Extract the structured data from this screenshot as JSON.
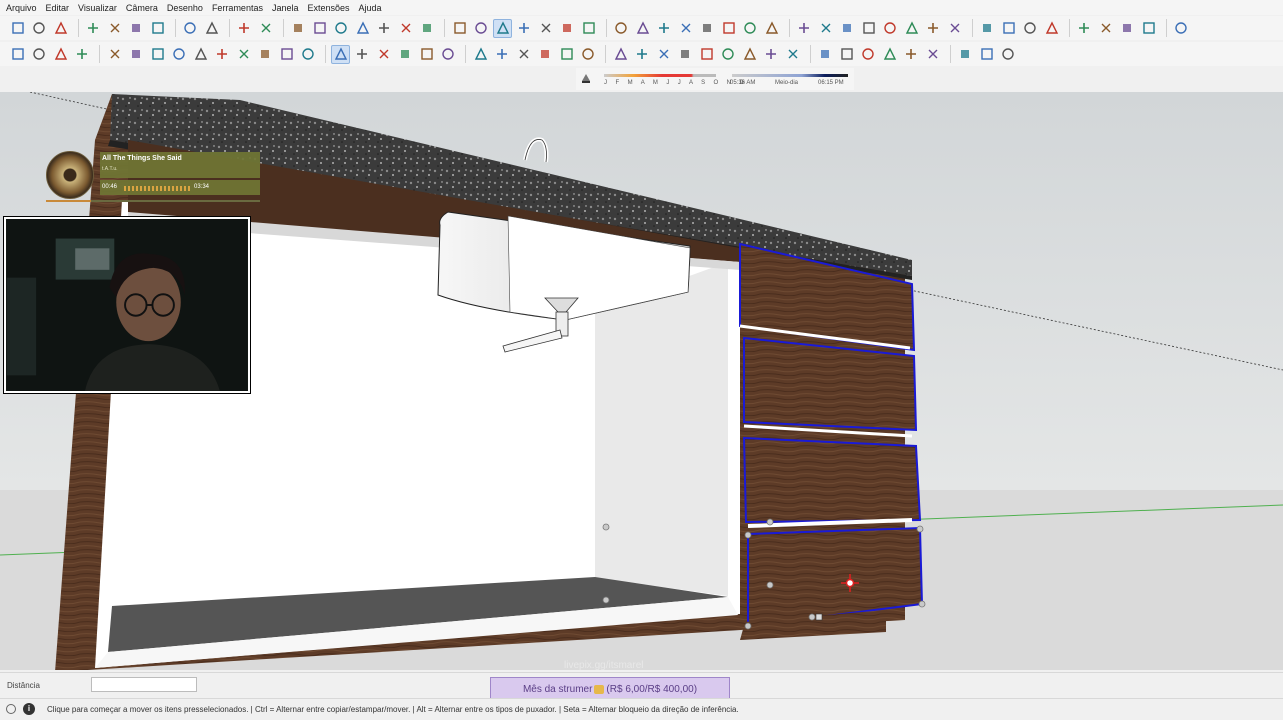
{
  "menu": [
    "Arquivo",
    "Editar",
    "Visualizar",
    "Câmera",
    "Desenho",
    "Ferramentas",
    "Janela",
    "Extensões",
    "Ajuda"
  ],
  "toolbar1": {
    "icons": [
      "new-file-icon",
      "open-file-icon",
      "save-icon",
      "cut-icon",
      "copy-icon",
      "paste-icon",
      "erase-icon",
      "undo-icon",
      "redo-icon",
      "print-icon",
      "model-info-icon",
      "iso-view-icon",
      "top-view-icon",
      "front-view-icon",
      "right-view-icon",
      "back-view-icon",
      "left-view-icon",
      "bottom-view-icon",
      "xray-icon",
      "back-edges-icon",
      "wireframe-icon",
      "hidden-line-icon",
      "shaded-icon",
      "shaded-textures-icon",
      "monochrome-icon",
      "section-plane-icon",
      "display-section-icon",
      "display-cuts-icon",
      "section-fill-icon",
      "components-icon",
      "warehouse-icon",
      "extension-warehouse-icon",
      "layout-icon",
      "model-info-2-icon",
      "entity-info-icon",
      "materials-icon",
      "styles-icon",
      "tags-icon",
      "scenes-icon",
      "shadows-icon",
      "fog-icon",
      "add-location-icon",
      "toggle-terrain-icon",
      "preview-icon",
      "cloud-icon",
      "settings-icon",
      "outliner-icon",
      "info-icon",
      "cart-icon",
      "account-icon"
    ],
    "active": [
      20
    ]
  },
  "toolbar2": {
    "icons": [
      "select-icon",
      "component-icon",
      "paint-bucket-icon",
      "eraser-icon",
      "pencil-icon",
      "freehand-icon",
      "rectangle-icon",
      "rotated-rectangle-icon",
      "circle-icon",
      "polygon-icon",
      "arc-icon",
      "two-point-arc-icon",
      "three-point-arc-icon",
      "pie-icon",
      "move-icon",
      "push-pull-icon",
      "rotate-icon",
      "scale-icon",
      "follow-me-icon",
      "offset-icon",
      "tape-measure-icon",
      "dimension-icon",
      "protractor-icon",
      "text-icon",
      "axes-icon",
      "3d-text-icon",
      "orbit-icon",
      "pan-icon",
      "zoom-icon",
      "zoom-window-icon",
      "zoom-extents-icon",
      "previous-view-icon",
      "position-camera-icon",
      "look-around-icon",
      "walk-icon",
      "solid-outer-icon",
      "solid-intersect-icon",
      "solid-union-icon",
      "solid-subtract-icon",
      "solid-trim-icon",
      "solid-split-icon",
      "sandbox-icon",
      "smoove-icon",
      "stamp-icon"
    ],
    "active": [
      14
    ]
  },
  "shadow": {
    "months": "J F M A M J J A S O N D",
    "time_start": "05:36 AM",
    "time_mid": "Meio-dia",
    "time_end": "06:15 PM"
  },
  "music": {
    "song": "All The Things She Said",
    "artist": "t.A.T.u.",
    "current_time": "00:46",
    "total_time": "03:34",
    "progress": 0.21
  },
  "value_label": "Distância",
  "value": "",
  "overlay": {
    "livepix": "livepix.gg/itsmarel",
    "goal_prefix": "Mês da strumer",
    "goal_amount": "(R$ 6,00/R$ 400,00)"
  },
  "status_text": "Clique para começar a mover os itens presselecionados. | Ctrl = Alternar entre copiar/estampar/mover. | Alt = Alternar entre os tipos de puxador. | Seta = Alternar bloqueio da direção de inferência.",
  "colors": {
    "selection": "#1a1ad6",
    "wood": "#5b3a26",
    "granite": "#3a3a3a",
    "axis_green": "#3ba83b",
    "goal_bg": "#d9c9ee"
  }
}
